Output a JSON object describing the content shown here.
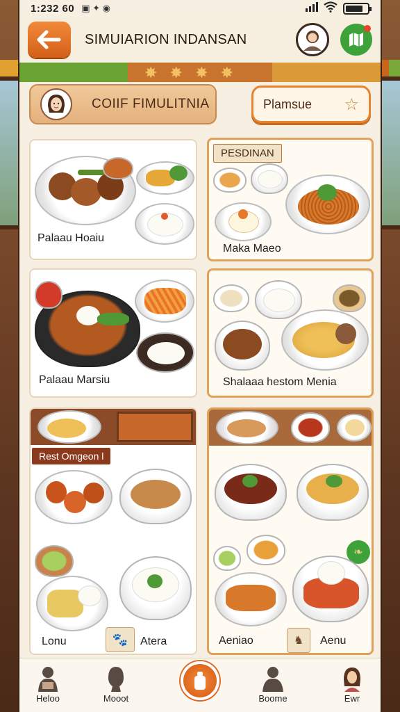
{
  "status": {
    "time": "1:232 60"
  },
  "header": {
    "title": "SIMUIARION INDANSAN"
  },
  "chef": {
    "label": "COIIF FIMULITNIA"
  },
  "simulation_button": {
    "label": "Plamsue"
  },
  "cards": [
    {
      "label": "Palaau Hoaiu",
      "tag": ""
    },
    {
      "label": "Maka Maeo",
      "tag": "PESDINAN"
    },
    {
      "label": "Palaau Marsiu",
      "tag": ""
    },
    {
      "label": "Shalaaa hestom Menia",
      "tag": ""
    },
    {
      "label": "Lonu",
      "tag": "Rest Omgeon l",
      "sub_label": "Atera"
    },
    {
      "label": "Aeniao",
      "tag": "",
      "sub_label": "Aenu"
    }
  ],
  "bottom_nav": [
    {
      "label": "Heloo"
    },
    {
      "label": "Mooot"
    },
    {
      "label": ""
    },
    {
      "label": "Boome"
    },
    {
      "label": "Ewr"
    }
  ],
  "colors": {
    "accent": "#e0692a",
    "brand_brown": "#8b3a1e",
    "map_green": "#3ea23a",
    "background": "#f7efe2"
  }
}
